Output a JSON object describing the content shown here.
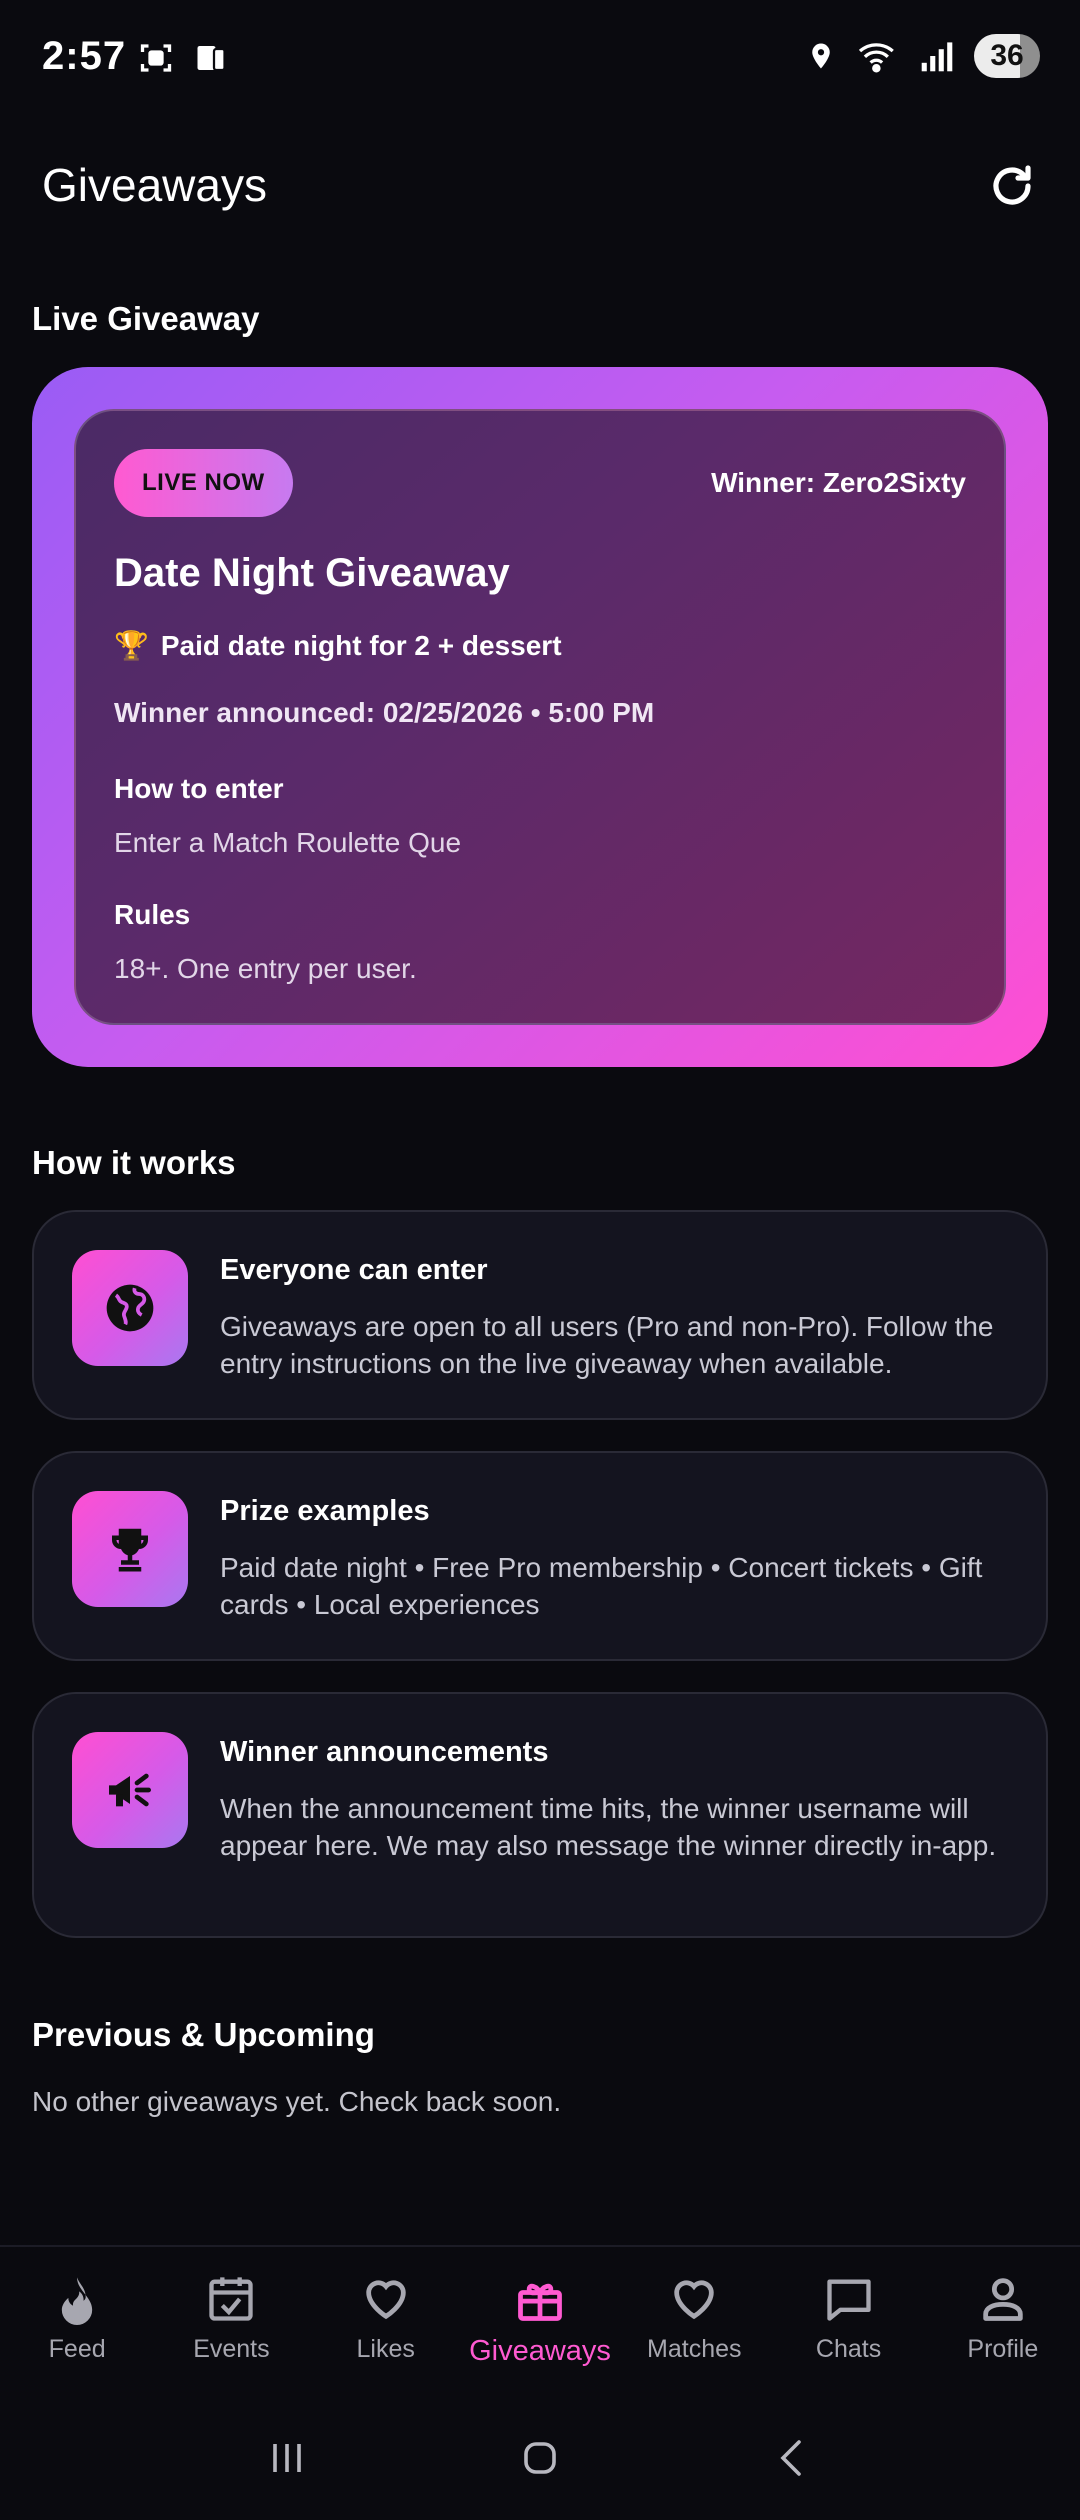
{
  "status_bar": {
    "time": "2:57",
    "battery": "36"
  },
  "header": {
    "title": "Giveaways"
  },
  "live_section": {
    "heading": "Live Giveaway",
    "badge": "LIVE NOW",
    "winner": "Winner: Zero2Sixty",
    "title": "Date Night Giveaway",
    "prize_emoji": "🏆",
    "prize": "Paid date night for 2 + dessert",
    "announcement": "Winner announced: 02/25/2026 • 5:00 PM",
    "how_to_enter_label": "How to enter",
    "how_to_enter_text": "Enter a Match Roulette Que",
    "rules_label": "Rules",
    "rules_text": "18+. One entry per user."
  },
  "how_it_works": {
    "heading": "How it works",
    "cards": [
      {
        "icon": "globe-icon",
        "title": "Everyone can enter",
        "body": "Giveaways are open to all users (Pro and non-Pro). Follow the entry instructions on the live giveaway when available."
      },
      {
        "icon": "trophy-icon",
        "title": "Prize examples",
        "body": "Paid date night • Free Pro membership • Concert tickets • Gift cards • Local experiences"
      },
      {
        "icon": "megaphone-icon",
        "title": "Winner announcements",
        "body": "When the announcement time hits, the winner username will appear here. We may also message the winner directly in-app."
      }
    ]
  },
  "previous_section": {
    "heading": "Previous & Upcoming",
    "empty_text": "No other giveaways yet. Check back soon."
  },
  "bottom_nav": {
    "active_color": "#ff5ad1",
    "items": [
      {
        "label": "Feed",
        "icon": "flame-icon"
      },
      {
        "label": "Events",
        "icon": "calendar-check-icon"
      },
      {
        "label": "Likes",
        "icon": "heart-icon"
      },
      {
        "label": "Giveaways",
        "icon": "gift-icon",
        "active": true
      },
      {
        "label": "Matches",
        "icon": "heart-outline-icon"
      },
      {
        "label": "Chats",
        "icon": "chat-bubble-icon"
      },
      {
        "label": "Profile",
        "icon": "person-icon"
      }
    ]
  }
}
